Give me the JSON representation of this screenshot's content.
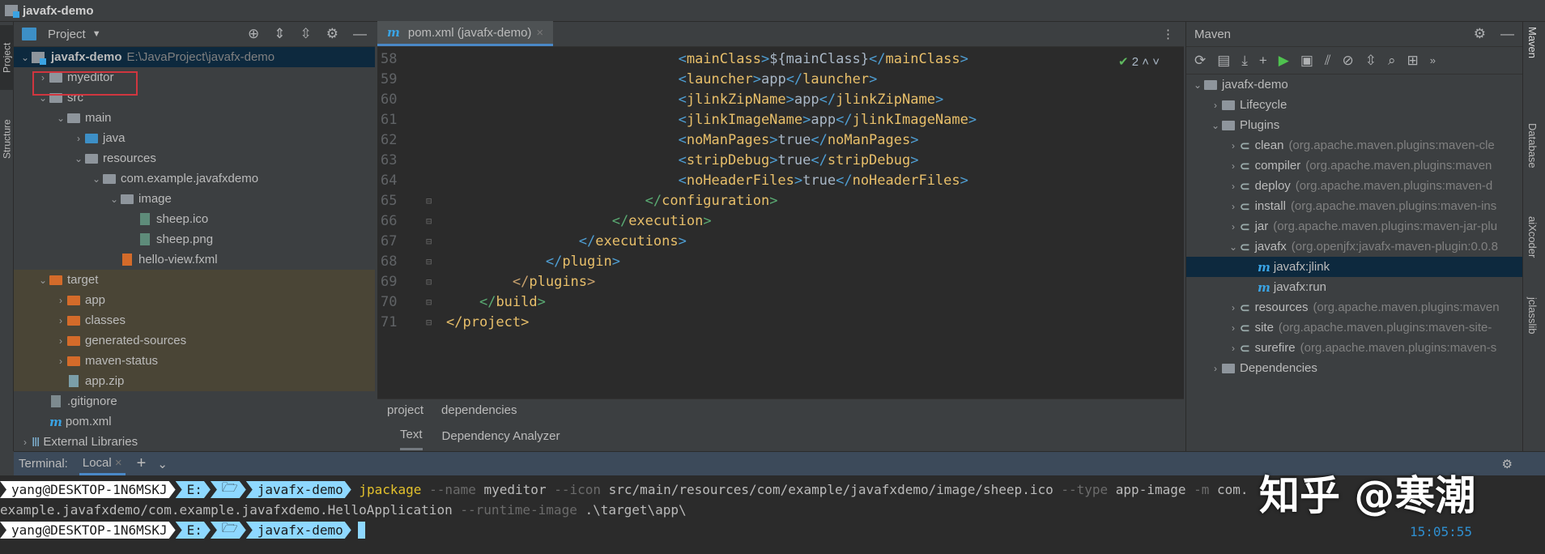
{
  "window": {
    "title": "javafx-demo"
  },
  "left_stripe": {
    "project": "Project",
    "structure": "Structure"
  },
  "project_panel": {
    "title": "Project",
    "rows": [
      {
        "depth": 0,
        "chev": "v",
        "icon": "module",
        "label": "javafx-demo",
        "sub": "E:\\JavaProject\\javafx-demo",
        "bold": true,
        "selected": true
      },
      {
        "depth": 1,
        "chev": ">",
        "icon": "folder",
        "label": "myeditor",
        "highlight": true
      },
      {
        "depth": 1,
        "chev": "v",
        "icon": "folder",
        "label": "src"
      },
      {
        "depth": 2,
        "chev": "v",
        "icon": "folder",
        "label": "main"
      },
      {
        "depth": 3,
        "chev": ">",
        "icon": "folder-blue",
        "label": "java"
      },
      {
        "depth": 3,
        "chev": "v",
        "icon": "folder",
        "label": "resources"
      },
      {
        "depth": 4,
        "chev": "v",
        "icon": "folder",
        "label": "com.example.javafxdemo"
      },
      {
        "depth": 5,
        "chev": "v",
        "icon": "folder",
        "label": "image"
      },
      {
        "depth": 6,
        "chev": "",
        "icon": "image-file",
        "label": "sheep.ico"
      },
      {
        "depth": 6,
        "chev": "",
        "icon": "image-file",
        "label": "sheep.png"
      },
      {
        "depth": 5,
        "chev": "",
        "icon": "fxml-file",
        "label": "hello-view.fxml"
      },
      {
        "depth": 1,
        "chev": "v",
        "icon": "folder-orange",
        "label": "target",
        "excluded": true
      },
      {
        "depth": 2,
        "chev": ">",
        "icon": "folder-orange",
        "label": "app",
        "excluded": true
      },
      {
        "depth": 2,
        "chev": ">",
        "icon": "folder-orange",
        "label": "classes",
        "excluded": true
      },
      {
        "depth": 2,
        "chev": ">",
        "icon": "folder-orange",
        "label": "generated-sources",
        "excluded": true
      },
      {
        "depth": 2,
        "chev": ">",
        "icon": "folder-orange",
        "label": "maven-status",
        "excluded": true
      },
      {
        "depth": 2,
        "chev": "",
        "icon": "zip-file",
        "label": "app.zip",
        "excluded": true
      },
      {
        "depth": 1,
        "chev": "",
        "icon": "file",
        "label": ".gitignore"
      },
      {
        "depth": 1,
        "chev": "",
        "icon": "maven",
        "label": "pom.xml"
      },
      {
        "depth": 0,
        "chev": ">",
        "icon": "library",
        "label": "External Libraries"
      }
    ]
  },
  "editor": {
    "tab": "pom.xml (javafx-demo)",
    "inspection_count": "2",
    "lines": [
      {
        "n": "58",
        "indent": 7,
        "tag": "mainClass",
        "text": "${mainClass}"
      },
      {
        "n": "59",
        "indent": 7,
        "tag": "launcher",
        "text": "app"
      },
      {
        "n": "60",
        "indent": 7,
        "tag": "jlinkZipName",
        "text": "app"
      },
      {
        "n": "61",
        "indent": 7,
        "tag": "jlinkImageName",
        "text": "app"
      },
      {
        "n": "62",
        "indent": 7,
        "tag": "noManPages",
        "text": "true"
      },
      {
        "n": "63",
        "indent": 7,
        "tag": "stripDebug",
        "text": "true"
      },
      {
        "n": "64",
        "indent": 7,
        "tag": "noHeaderFiles",
        "text": "true"
      },
      {
        "n": "65",
        "indent": 6,
        "close": "configuration"
      },
      {
        "n": "66",
        "indent": 5,
        "close": "execution"
      },
      {
        "n": "67",
        "indent": 4,
        "close": "executions"
      },
      {
        "n": "68",
        "indent": 3,
        "close": "plugin"
      },
      {
        "n": "69",
        "indent": 2,
        "close": "plugins"
      },
      {
        "n": "70",
        "indent": 1,
        "close": "build"
      },
      {
        "n": "71",
        "indent": 0,
        "close": "project"
      }
    ],
    "breadcrumbs": [
      "project",
      "dependencies"
    ],
    "bottom_tabs": [
      "Text",
      "Dependency Analyzer"
    ]
  },
  "maven": {
    "title": "Maven",
    "rows": [
      {
        "depth": 0,
        "chev": "v",
        "label": "javafx-demo"
      },
      {
        "depth": 1,
        "chev": ">",
        "label": "Lifecycle"
      },
      {
        "depth": 1,
        "chev": "v",
        "label": "Plugins"
      },
      {
        "depth": 2,
        "chev": ">",
        "label": "clean",
        "sub": "(org.apache.maven.plugins:maven-cle"
      },
      {
        "depth": 2,
        "chev": ">",
        "label": "compiler",
        "sub": "(org.apache.maven.plugins:maven"
      },
      {
        "depth": 2,
        "chev": ">",
        "label": "deploy",
        "sub": "(org.apache.maven.plugins:maven-d"
      },
      {
        "depth": 2,
        "chev": ">",
        "label": "install",
        "sub": "(org.apache.maven.plugins:maven-ins"
      },
      {
        "depth": 2,
        "chev": ">",
        "label": "jar",
        "sub": "(org.apache.maven.plugins:maven-jar-plu"
      },
      {
        "depth": 2,
        "chev": "v",
        "label": "javafx",
        "sub": "(org.openjfx:javafx-maven-plugin:0.0.8"
      },
      {
        "depth": 3,
        "chev": "",
        "label": "javafx:jlink",
        "goal": true,
        "selected": true
      },
      {
        "depth": 3,
        "chev": "",
        "label": "javafx:run",
        "goal": true
      },
      {
        "depth": 2,
        "chev": ">",
        "label": "resources",
        "sub": "(org.apache.maven.plugins:maven"
      },
      {
        "depth": 2,
        "chev": ">",
        "label": "site",
        "sub": "(org.apache.maven.plugins:maven-site-"
      },
      {
        "depth": 2,
        "chev": ">",
        "label": "surefire",
        "sub": "(org.apache.maven.plugins:maven-s"
      },
      {
        "depth": 1,
        "chev": ">",
        "label": "Dependencies"
      }
    ]
  },
  "right_stripe": {
    "maven": "Maven",
    "database": "Database",
    "aixcoder": "aiXcoder",
    "jclasslib": "jclasslib"
  },
  "terminal": {
    "label": "Terminal:",
    "tab": "Local",
    "prompt": {
      "user": "yang@DESKTOP-1N6MSKJ",
      "drive": "E:",
      "dir": "javafx-demo"
    },
    "cmd": {
      "exe": "jpackage",
      "a1": " --name",
      "v1": " myeditor",
      "a2": " --icon",
      "v2": " src/main/resources/com/example/javafxdemo/image/sheep.ico",
      "a3": " --type",
      "v3": " app-image",
      "a4": " -m",
      "v4": " com.",
      "line2a": "example.javafxdemo/com.example.javafxdemo.HelloApplication",
      "a5": " --runtime-image",
      "v5": " .\\target\\app\\"
    },
    "time": "15:05:55"
  },
  "watermark": "知乎 @寒潮"
}
